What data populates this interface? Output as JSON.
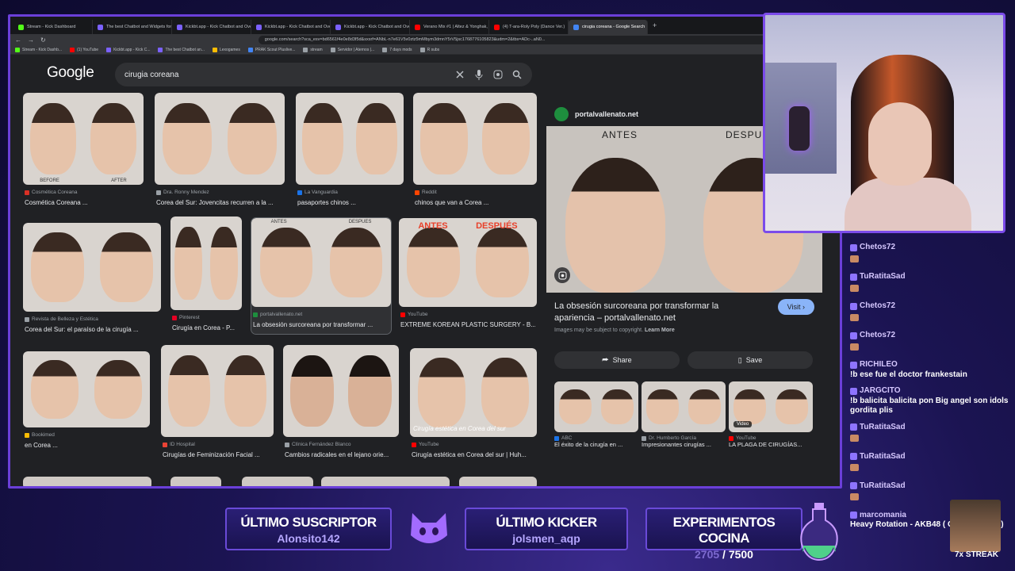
{
  "browser": {
    "tabs": [
      {
        "title": "Stream - Kick Dashboard",
        "color": "#53fc18"
      },
      {
        "title": "The best Chatbot and Widgets for K",
        "color": "#7b61ff"
      },
      {
        "title": "Kickbt.app - Kick Chatbot and Overl",
        "color": "#7b61ff"
      },
      {
        "title": "Kickbt.app - Kick Chatbot and Overl",
        "color": "#7b61ff"
      },
      {
        "title": "Kickbt.app - Kick Chatbot and Overl",
        "color": "#7b61ff"
      },
      {
        "title": "Verano Mix #1 | Altez & Yonghak, Ju",
        "color": "#ff0000"
      },
      {
        "title": "(4) T-ara-Roly Poly (Dance Ver.)",
        "color": "#ff0000"
      },
      {
        "title": "cirugia coreana - Google Search",
        "color": "#4285f4",
        "active": true
      }
    ],
    "url": "google.com/search?sca_esv=bd6561f4e0e8d3f5d&sxsrf=ANbL-n7e61V5v0ztz5mMbym3dmnY5rV5jsc1768776105823&udm=2&tbs=ADc-..aN0...",
    "bookmarks": [
      "Stream - Kick Dashb...",
      "(1) YouTube",
      "Kickbt.app - Kick C...",
      "The best Chatbot an...",
      "Lexogames",
      "PRAK Scout Pluslive...",
      "stream",
      "Servidor | Aternos |...",
      "7 days mods",
      "R subs"
    ]
  },
  "google": {
    "logo": "Google",
    "query": "cirugia coreana",
    "results": [
      {
        "source": "Cosmética Coreana",
        "caption": "Cosmética Coreana ...",
        "fav": "#d93025"
      },
      {
        "source": "Dra. Ronny Mendez",
        "caption": "Corea del Sur: Jovencitas recurren a la ...",
        "fav": "#9aa0a6"
      },
      {
        "source": "La Vanguardia",
        "caption": "pasaportes chinos ...",
        "fav": "#1a73e8"
      },
      {
        "source": "Reddit",
        "caption": "chinos que van a Corea ...",
        "fav": "#ff4500"
      },
      {
        "source": "Revista de Belleza y Estética",
        "caption": "Corea del Sur: el paraíso de la cirugía ...",
        "fav": "#9aa0a6"
      },
      {
        "source": "Pinterest",
        "caption": "Cirugía en Corea - P...",
        "fav": "#e60023"
      },
      {
        "source": "portalvallenato.net",
        "caption": "La obsesión surcoreana por transformar ...",
        "fav": "#1e8e3e"
      },
      {
        "source": "YouTube",
        "caption": "EXTREME KOREAN PLASTIC SURGERY - B...",
        "fav": "#ff0000"
      },
      {
        "source": "Bookimed",
        "caption": "en Corea ...",
        "fav": "#fbbc04"
      },
      {
        "source": "ID Hospital",
        "caption": "Cirugías de Feminización Facial ...",
        "fav": "#ea4335"
      },
      {
        "source": "Clínica Fernández Blanco",
        "caption": "Cambios radicales en el lejano orie...",
        "fav": "#9aa0a6"
      },
      {
        "source": "YouTube",
        "caption": "Cirugía estética en Corea del sur | Huh...",
        "fav": "#ff0000"
      }
    ],
    "image_text": {
      "before": "BEFORE",
      "after": "AFTER",
      "antes": "ANTES",
      "despues": "DESPUES",
      "antes2": "ANTES",
      "despues2": "DESPUÉS",
      "overlay_en_corea": "Cirugía estética en Corea del sur"
    },
    "panel": {
      "site": "portalvallenato.net",
      "before_tag": "ANTES",
      "after_tag": "DESPUE",
      "title": "La obsesión surcoreana por transformar la apariencia – portalvallenato.net",
      "visit": "Visit",
      "copyright": "Images may be subject to copyright.",
      "learn_more": "Learn More",
      "share": "Share",
      "save": "Save",
      "related": [
        {
          "source": "ABC",
          "caption": "El éxito de la cirugía en ...",
          "fav": "#1a73e8"
        },
        {
          "source": "Dr. Humberto García",
          "caption": "Impresionantes cirugías ...",
          "fav": "#9aa0a6"
        },
        {
          "source": "YouTube",
          "caption": "LA PLAGA DE CIRUGÍAS...",
          "fav": "#ff0000"
        }
      ],
      "video_badge": "Video"
    }
  },
  "chat": [
    {
      "user": "Chetos72",
      "text": ""
    },
    {
      "user": "TuRatitaSad",
      "text": ""
    },
    {
      "user": "Chetos72",
      "text": ""
    },
    {
      "user": "Chetos72",
      "text": ""
    },
    {
      "user": "RICHILEO",
      "text": "!b ese fue el doctor frankestain"
    },
    {
      "user": "JARGCITO",
      "text": "!b balicita balicita pon Big angel son idols gordita plis"
    },
    {
      "user": "TuRatitaSad",
      "text": ""
    },
    {
      "user": "TuRatitaSad",
      "text": ""
    },
    {
      "user": "TuRatitaSad",
      "text": ""
    },
    {
      "user": "marcomania",
      "text": "Heavy Rotation - AKB48 ( Closing Song )"
    }
  ],
  "overlay": {
    "sub_label": "ÚLTIMO SUSCRIPTOR",
    "sub_value": "Alonsito142",
    "kicker_label": "ÚLTIMO KICKER",
    "kicker_value": "jolsmen_aqp",
    "goal_label": "EXPERIMENTOS COCINA",
    "goal_current": "2705",
    "goal_sep": " / ",
    "goal_target": "7500",
    "goal_progress": 0.36,
    "streak": "7x STREAK"
  },
  "colors": {
    "accent": "#7b4bea",
    "chrome_bg": "#202124",
    "visit_blue": "#8ab4f8"
  }
}
